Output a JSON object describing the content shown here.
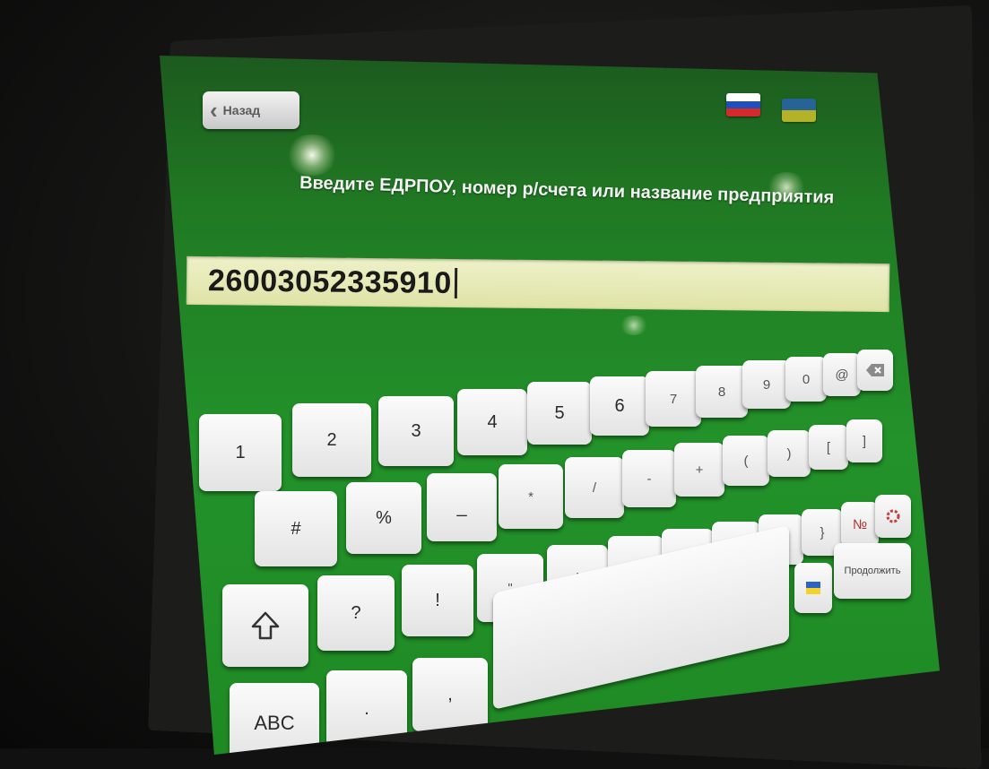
{
  "header": {
    "back_label": "Назад",
    "lang_flags": [
      {
        "name": "russian",
        "colors": [
          "#ffffff",
          "#1f4fbf",
          "#d42a2a"
        ]
      },
      {
        "name": "ukrainian",
        "colors": [
          "#2a64c8",
          "#f2d22c"
        ]
      }
    ]
  },
  "prompt": "Введите ЕДРПОУ, номер р/счета или название предприятия",
  "input": {
    "value": "26003052335910"
  },
  "keyboard": {
    "row1": [
      "1",
      "2",
      "3",
      "4",
      "5",
      "6",
      "7",
      "8",
      "9",
      "0",
      "@"
    ],
    "row2": [
      "#",
      "%",
      "_",
      "*",
      "/",
      "-",
      "+",
      "(",
      ")",
      "[",
      "]"
    ],
    "row3": [
      "?",
      "!",
      "\"",
      "'",
      ";",
      ":",
      "|",
      "{",
      "}",
      "№"
    ],
    "row4": [
      ".",
      ","
    ],
    "abc_label": "ABC",
    "continue_label": "Продолжить",
    "icons": {
      "backspace": "backspace-icon",
      "shift": "shift-icon",
      "settings": "settings-icon",
      "language": "ukrainian-flag-icon"
    }
  },
  "colors": {
    "screen_green": "#23922a",
    "input_bg": "#e6eab6",
    "key_bg": "#f2f2f2"
  }
}
